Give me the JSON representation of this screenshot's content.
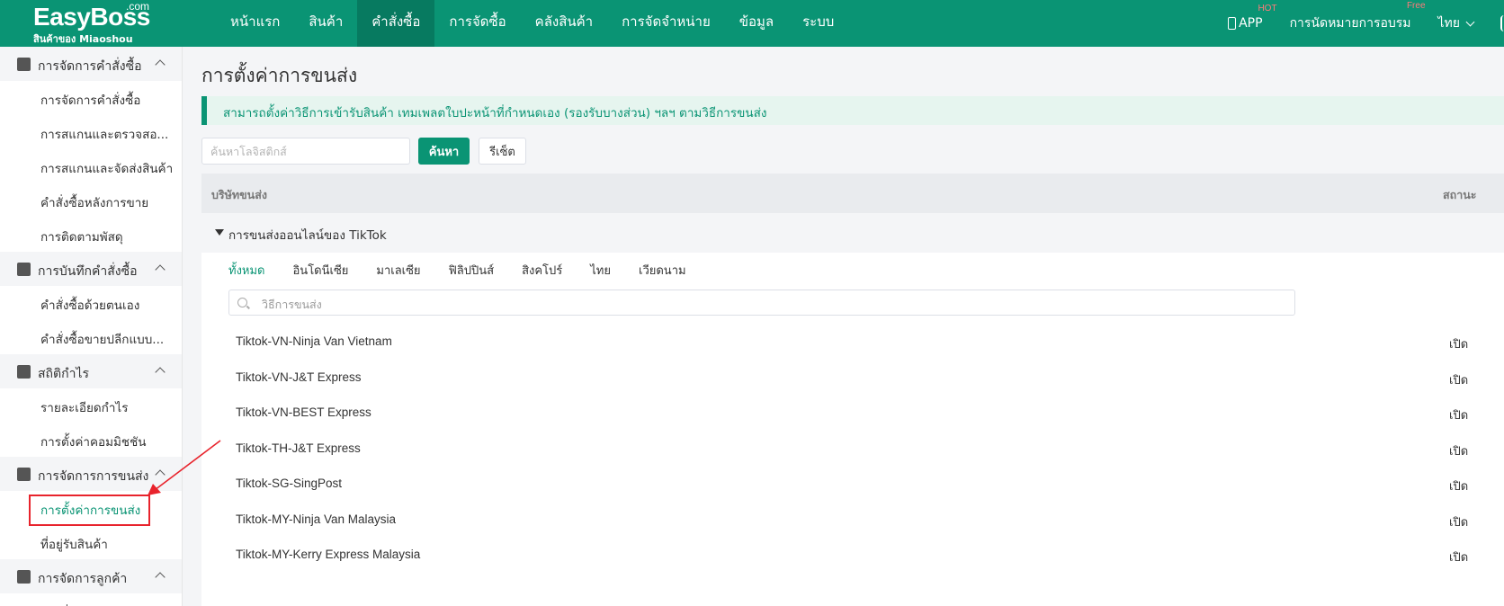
{
  "header": {
    "logo_main": "EasyBoss",
    "logo_com": ".com",
    "logo_sub": "สินค้าของ Miaoshou",
    "nav": [
      "หน้าแรก",
      "สินค้า",
      "คำสั่งซื้อ",
      "การจัดซื้อ",
      "คลังสินค้า",
      "การจัดจำหน่าย",
      "ข้อมูล",
      "ระบบ"
    ],
    "active_nav": 2,
    "app_label": "APP",
    "app_badge": "HOT",
    "training_label": "การนัดหมายการอบรม",
    "training_badge": "Free",
    "language": "ไทย"
  },
  "sidebar": {
    "groups": [
      {
        "label": "การจัดการคำสั่งซื้อ",
        "icon": "clipboard-icon",
        "items": [
          "การจัดการคำสั่งซื้อ",
          "การสแกนและตรวจสอ...",
          "การสแกนและจัดส่งสินค้า",
          "คำสั่งซื้อหลังการขาย",
          "การติดตามพัสดุ"
        ]
      },
      {
        "label": "การบันทึกคำสั่งซื้อ",
        "icon": "notebook-icon",
        "items": [
          "คำสั่งซื้อด้วยตนเอง",
          "คำสั่งซื้อขายปลีกแบบ..."
        ]
      },
      {
        "label": "สถิติกำไร",
        "icon": "coins-icon",
        "items": [
          "รายละเอียดกำไร",
          "การตั้งค่าคอมมิชชัน"
        ]
      },
      {
        "label": "การจัดการการขนส่ง",
        "icon": "truck-icon",
        "items": [
          "การตั้งค่าการขนส่ง",
          "ที่อยู่รับสินค้า"
        ]
      },
      {
        "label": "การจัดการลูกค้า",
        "icon": "customer-icon",
        "items": [
          "รายชื่อลูกค้า"
        ]
      }
    ],
    "active_item": "การตั้งค่าการขนส่ง"
  },
  "main": {
    "title": "การตั้งค่าการขนส่ง",
    "notice": "สามารถตั้งค่าวิธีการเข้ารับสินค้า เทมเพลตใบปะหน้าที่กำหนดเอง (รองรับบางส่วน) ฯลฯ ตามวิธีการขนส่ง",
    "search_placeholder": "ค้นหาโลจิสติกส์",
    "search_button": "ค้นหา",
    "reset_button": "รีเซ็ต",
    "table": {
      "col_carrier": "บริษัทขนส่ง",
      "col_status": "สถานะ",
      "group_label": "การขนส่งออนไลน์ของ TikTok",
      "tabs": [
        "ทั้งหมด",
        "อินโดนีเซีย",
        "มาเลเซีย",
        "ฟิลิปปินส์",
        "สิงคโปร์",
        "ไทย",
        "เวียดนาม"
      ],
      "active_tab": 0,
      "method_placeholder": "วิธีการขนส่ง",
      "rows": [
        {
          "name": "Tiktok-VN-Ninja Van Vietnam",
          "status": "เปิด"
        },
        {
          "name": "Tiktok-VN-J&T Express",
          "status": "เปิด"
        },
        {
          "name": "Tiktok-VN-BEST Express",
          "status": "เปิด"
        },
        {
          "name": "Tiktok-TH-J&T Express",
          "status": "เปิด"
        },
        {
          "name": "Tiktok-SG-SingPost",
          "status": "เปิด"
        },
        {
          "name": "Tiktok-MY-Ninja Van Malaysia",
          "status": "เปิด"
        },
        {
          "name": "Tiktok-MY-Kerry Express Malaysia",
          "status": "เปิด"
        }
      ]
    }
  },
  "colors": {
    "brand": "#0a9474",
    "annotation": "#e8232c"
  }
}
